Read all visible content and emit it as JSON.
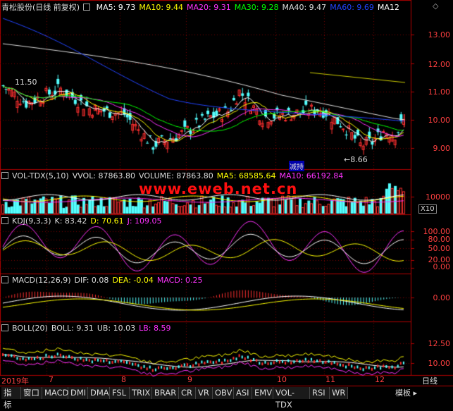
{
  "main": {
    "title": "青松股份(日线 前复权)",
    "ma_labels": [
      "MA5: 9.73",
      "MA10: 9.44",
      "MA20: 9.31",
      "MA30: 9.28",
      "MA40: 9.47",
      "MA60: 9.69",
      "MA12"
    ],
    "ma_colors": [
      "#ffffff",
      "#ffff00",
      "#ff33ff",
      "#00ff00",
      "#dddddd",
      "#2244ff",
      "#ffffff"
    ],
    "hi_label": "11.50",
    "lo_label": "8.66",
    "marker": "减持",
    "y_ticks": [
      "13.00",
      "12.00",
      "11.00",
      "10.00",
      "9.00"
    ]
  },
  "vol": {
    "labels": [
      "VOL-TDX(5,10)",
      "VVOL: 87863.80",
      "VOLUME: 87863.80",
      "MA5: 68585.64",
      "MA10: 66192.84"
    ],
    "colors": [
      "#dddddd",
      "#dddddd",
      "#dddddd",
      "#ffff00",
      "#ff33ff"
    ],
    "tick": "10000",
    "unit": "X10"
  },
  "kdj": {
    "labels": [
      "KDJ(9,3,3)",
      "K: 83.42",
      "D: 70.61",
      "J: 109.05"
    ],
    "colors": [
      "#dddddd",
      "#dddddd",
      "#ffff00",
      "#ff33ff"
    ],
    "ticks": [
      "100.00",
      "80.00",
      "50.00",
      "20.00",
      "0.00"
    ]
  },
  "macd": {
    "labels": [
      "MACD(12,26,9)",
      "DIF: 0.08",
      "DEA: -0.04",
      "MACD: 0.25"
    ],
    "colors": [
      "#dddddd",
      "#dddddd",
      "#ffff00",
      "#ff33ff"
    ],
    "tick": "0.00"
  },
  "boll": {
    "labels": [
      "BOLL(20)",
      "BOLL: 9.31",
      "UB: 10.03",
      "LB: 8.59"
    ],
    "colors": [
      "#dddddd",
      "#dddddd",
      "#dddddd",
      "#ff33ff"
    ],
    "ticks": [
      "12.50",
      "10.00"
    ]
  },
  "xaxis": {
    "labels": [
      "2019年",
      "7",
      "8",
      "9",
      "10",
      "11",
      "12"
    ]
  },
  "period_label": "日线",
  "watermark": "www.eweb.net.cn",
  "tabs": [
    "指标",
    "窗口",
    "MACD",
    "DMI",
    "DMA",
    "FSL",
    "TRIX",
    "BRAR",
    "CR",
    "VR",
    "OBV",
    "ASI",
    "EMV",
    "VOL-TDX",
    "RSI",
    "WR"
  ],
  "template_label": "模板"
}
